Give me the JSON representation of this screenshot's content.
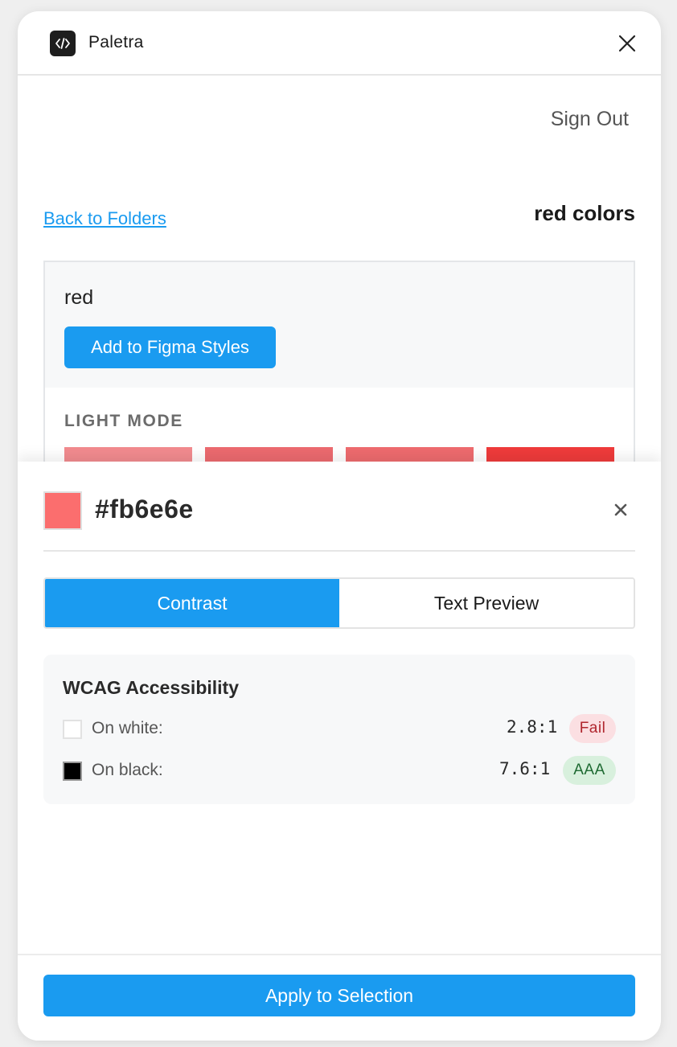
{
  "header": {
    "app_name": "Paletra",
    "logo_icon": "code-brackets-icon",
    "close_icon": "close-icon"
  },
  "account": {
    "sign_out_label": "Sign Out"
  },
  "navigation": {
    "back_label": "Back to Folders",
    "folder_title": "red colors"
  },
  "color_card": {
    "name": "red",
    "add_button_label": "Add to Figma Styles",
    "mode_label": "LIGHT MODE",
    "swatches": [
      "#f28b8f",
      "#ec6a6f",
      "#ee6b6e",
      "#ef3b3b"
    ]
  },
  "selected_color": {
    "hex": "#fb6e6e",
    "swatch_color": "#fb6e6e"
  },
  "tabs": [
    {
      "label": "Contrast",
      "active": true
    },
    {
      "label": "Text Preview",
      "active": false
    }
  ],
  "wcag": {
    "title": "WCAG Accessibility",
    "rows": [
      {
        "label": "On white:",
        "swatch": "#ffffff",
        "ratio": "2.8:1",
        "badge": "Fail",
        "badge_bg": "#fbdfe2",
        "badge_color": "#b0262e"
      },
      {
        "label": "On black:",
        "swatch": "#000000",
        "ratio": "7.6:1",
        "badge": "AAA",
        "badge_bg": "#d8f0dd",
        "badge_color": "#1e6a32"
      }
    ]
  },
  "footer": {
    "apply_label": "Apply to Selection"
  },
  "colors": {
    "accent": "#1a9bf0",
    "link": "#1a9bf0"
  }
}
